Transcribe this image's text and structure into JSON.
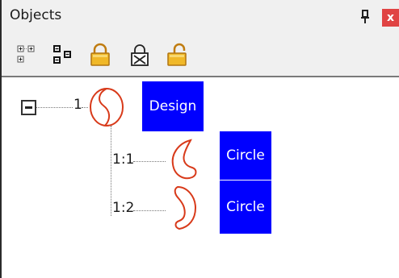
{
  "panel": {
    "title": "Objects",
    "pin_icon": "pin-icon",
    "close_label": "x"
  },
  "toolbar": {
    "buttons": [
      {
        "name": "expand-all-button",
        "icon": "expand-all-icon"
      },
      {
        "name": "collapse-all-button",
        "icon": "collapse-all-icon"
      },
      {
        "name": "lock-button",
        "icon": "lock-icon"
      },
      {
        "name": "lock-x-button",
        "icon": "lock-x-icon"
      },
      {
        "name": "unlock-button",
        "icon": "unlock-icon"
      }
    ]
  },
  "tree": {
    "root": {
      "number": "1",
      "label": "Design",
      "icon": "design-shape-icon",
      "expanded": true,
      "children": [
        {
          "number": "1:1",
          "label": "Circle",
          "icon": "circle-shape-icon"
        },
        {
          "number": "1:2",
          "label": "Circle",
          "icon": "circle-shape-icon"
        }
      ]
    }
  },
  "colors": {
    "selection": "#0000ff",
    "shape_outline": "#d83a1a",
    "toolbar_bg": "#f0f0f0",
    "close_bg": "#e04343"
  }
}
